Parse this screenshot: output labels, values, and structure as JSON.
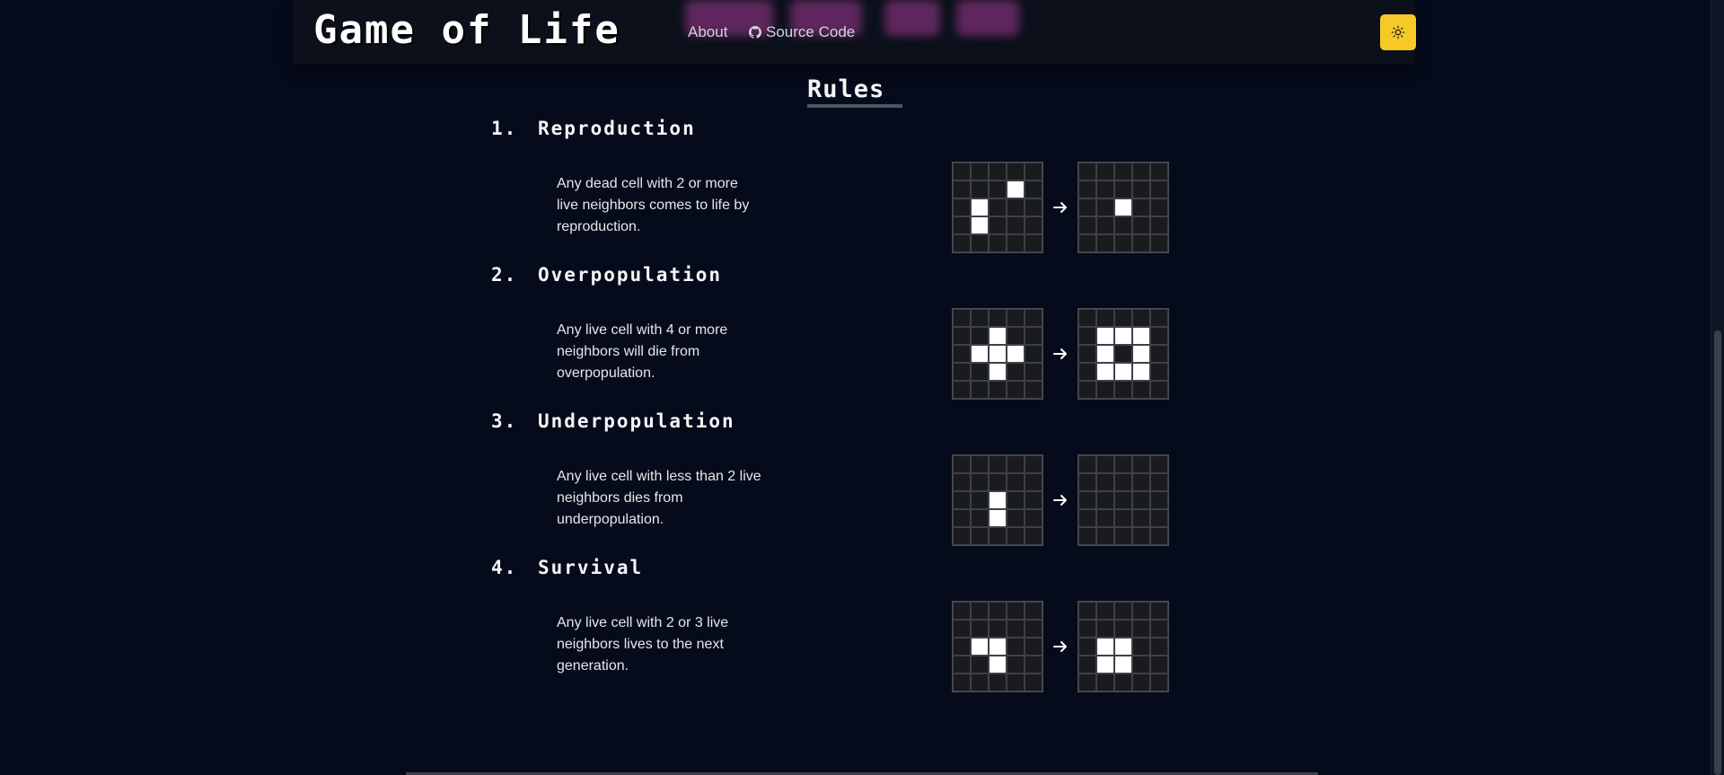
{
  "header": {
    "brand": "Game of Life",
    "nav": [
      {
        "label": "About"
      },
      {
        "label": "Source Code",
        "icon": "github-icon"
      }
    ],
    "theme_toggle_icon": "sun-icon",
    "accent": "#f6c926"
  },
  "rules": {
    "title": "Rules",
    "items": [
      {
        "number": "1.",
        "name": "Reproduction",
        "description": "Any dead cell with 2 or more live neighbors comes to life by reproduction.",
        "before": [
          [
            0,
            0,
            0,
            0,
            0
          ],
          [
            0,
            0,
            0,
            1,
            0
          ],
          [
            0,
            1,
            0,
            0,
            0
          ],
          [
            0,
            1,
            0,
            0,
            0
          ],
          [
            0,
            0,
            0,
            0,
            0
          ]
        ],
        "after": [
          [
            0,
            0,
            0,
            0,
            0
          ],
          [
            0,
            0,
            0,
            0,
            0
          ],
          [
            0,
            0,
            1,
            0,
            0
          ],
          [
            0,
            0,
            0,
            0,
            0
          ],
          [
            0,
            0,
            0,
            0,
            0
          ]
        ]
      },
      {
        "number": "2.",
        "name": "Overpopulation",
        "description": "Any live cell with 4 or more neighbors will die from overpopulation.",
        "before": [
          [
            0,
            0,
            0,
            0,
            0
          ],
          [
            0,
            0,
            1,
            0,
            0
          ],
          [
            0,
            1,
            1,
            1,
            0
          ],
          [
            0,
            0,
            1,
            0,
            0
          ],
          [
            0,
            0,
            0,
            0,
            0
          ]
        ],
        "after": [
          [
            0,
            0,
            0,
            0,
            0
          ],
          [
            0,
            1,
            1,
            1,
            0
          ],
          [
            0,
            1,
            0,
            1,
            0
          ],
          [
            0,
            1,
            1,
            1,
            0
          ],
          [
            0,
            0,
            0,
            0,
            0
          ]
        ]
      },
      {
        "number": "3.",
        "name": "Underpopulation",
        "description": "Any live cell with less than 2 live neighbors dies from underpopulation.",
        "before": [
          [
            0,
            0,
            0,
            0,
            0
          ],
          [
            0,
            0,
            0,
            0,
            0
          ],
          [
            0,
            0,
            1,
            0,
            0
          ],
          [
            0,
            0,
            1,
            0,
            0
          ],
          [
            0,
            0,
            0,
            0,
            0
          ]
        ],
        "after": [
          [
            0,
            0,
            0,
            0,
            0
          ],
          [
            0,
            0,
            0,
            0,
            0
          ],
          [
            0,
            0,
            0,
            0,
            0
          ],
          [
            0,
            0,
            0,
            0,
            0
          ],
          [
            0,
            0,
            0,
            0,
            0
          ]
        ]
      },
      {
        "number": "4.",
        "name": "Survival",
        "description": "Any live cell with 2 or 3 live neighbors lives to the next generation.",
        "before": [
          [
            0,
            0,
            0,
            0,
            0
          ],
          [
            0,
            0,
            0,
            0,
            0
          ],
          [
            0,
            1,
            1,
            0,
            0
          ],
          [
            0,
            0,
            1,
            0,
            0
          ],
          [
            0,
            0,
            0,
            0,
            0
          ]
        ],
        "after": [
          [
            0,
            0,
            0,
            0,
            0
          ],
          [
            0,
            0,
            0,
            0,
            0
          ],
          [
            0,
            1,
            1,
            0,
            0
          ],
          [
            0,
            1,
            1,
            0,
            0
          ],
          [
            0,
            0,
            0,
            0,
            0
          ]
        ]
      }
    ]
  }
}
